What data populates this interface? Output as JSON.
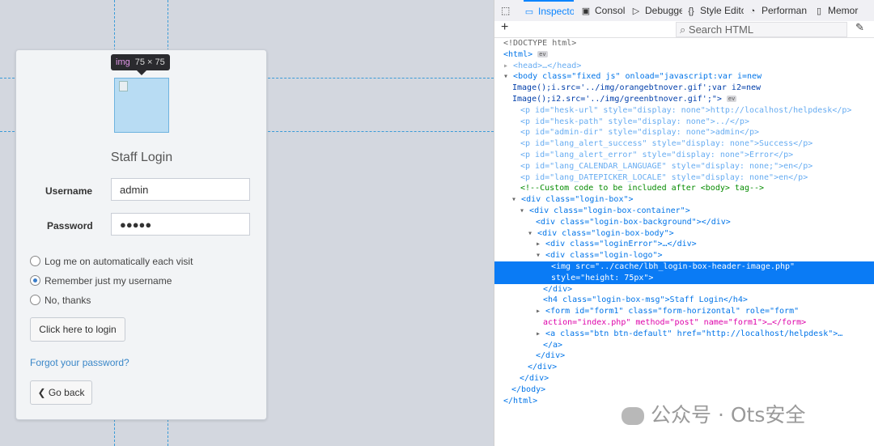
{
  "tooltip": {
    "tag": "img",
    "dims": "75 × 75"
  },
  "login": {
    "title": "Staff Login",
    "username_label": "Username",
    "username_value": "admin",
    "password_label": "Password",
    "password_value": "●●●●●",
    "radios": [
      {
        "label": "Log me on automatically each visit",
        "checked": false
      },
      {
        "label": "Remember just my username",
        "checked": true
      },
      {
        "label": "No, thanks",
        "checked": false
      }
    ],
    "login_button": "Click here to login",
    "forgot": "Forgot your password?",
    "back_button": "Go back"
  },
  "devtools": {
    "tabs": [
      {
        "label": "Inspecto",
        "icon": "inspector-icon"
      },
      {
        "label": "Consol",
        "icon": "console-icon"
      },
      {
        "label": "Debugge",
        "icon": "debugger-icon"
      },
      {
        "label": "Style Edito",
        "icon": "style-editor-icon"
      },
      {
        "label": "Performan",
        "icon": "performance-icon"
      },
      {
        "label": "Memor",
        "icon": "memory-icon"
      }
    ],
    "search_placeholder": "Search HTML",
    "lines": [
      "<!DOCTYPE html>",
      "<html>",
      "<head>…</head>",
      "<body class=\"fixed js\" onload=\"javascript:var i=new",
      "Image();i.src='../img/orangebtnover.gif';var i2=new",
      "Image();i2.src='../img/greenbtnover.gif';\">",
      "<p id=\"hesk-url\" style=\"display: none\">http://localhost/helpdesk</p>",
      "<p id=\"hesk-path\" style=\"display: none\">../</p>",
      "<p id=\"admin-dir\" style=\"display: none\">admin</p>",
      "<p id=\"lang_alert_success\" style=\"display: none\">Success</p>",
      "<p id=\"lang_alert_error\" style=\"display: none\">Error</p>",
      "<p id=\"lang_CALENDAR_LANGUAGE\" style=\"display: none;\">en</p>",
      "<p id=\"lang_DATEPICKER_LOCALE\" style=\"display: none\">en</p>",
      "<!--Custom code to be included after <body> tag-->",
      "<div class=\"login-box\">",
      "<div class=\"login-box-container\">",
      "<div class=\"login-box-background\"></div>",
      "<div class=\"login-box-body\">",
      "<div class=\"loginError\">…</div>",
      "<div class=\"login-logo\">",
      "<img src=\"../cache/lbh_login-box-header-image.php\"",
      "style=\"height: 75px\">",
      "</div>",
      "<h4 class=\"login-box-msg\">Staff Login</h4>",
      "<form id=\"form1\" class=\"form-horizontal\" role=\"form\"",
      "action=\"index.php\" method=\"post\" name=\"form1\">…</form>",
      "<a class=\"btn btn-default\" href=\"http://localhost/helpdesk\">…",
      "</a>",
      "</div>",
      "</div>",
      "</div>",
      "</body>",
      "</html>"
    ],
    "badge_event": "ev"
  },
  "watermark": "公众号 · Ots安全"
}
